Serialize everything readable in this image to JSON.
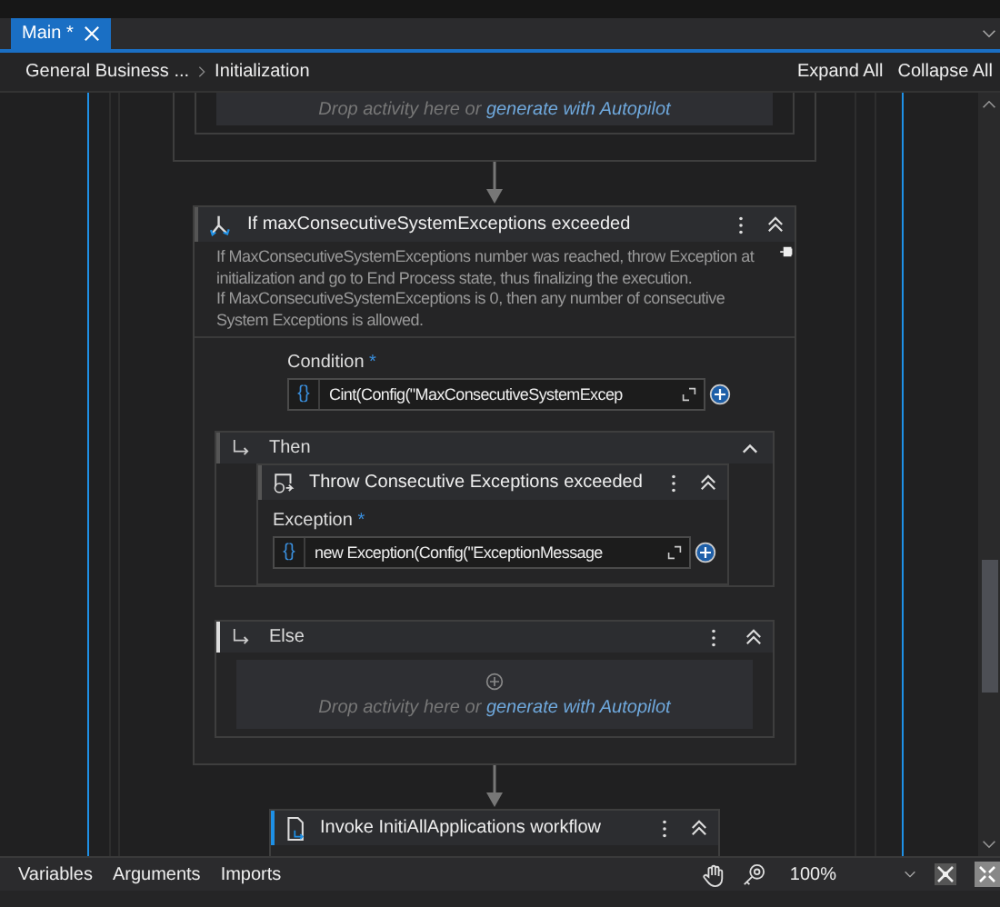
{
  "tabs": [
    {
      "label": "Main *",
      "selected": true
    }
  ],
  "breadcrumb": [
    "General Business ...",
    "Initialization"
  ],
  "toolbar_actions": [
    "Expand All",
    "Collapse All"
  ],
  "top_drop_zone": {
    "text": "Drop activity here or",
    "link": "generate with Autopilot"
  },
  "if_activity": {
    "title": "If maxConsecutiveSystemExceptions exceeded",
    "annotation": [
      "If MaxConsecutiveSystemExceptions number was reached, throw Exception at initialization and go to End Process state, thus finalizing the execution.",
      "If MaxConsecutiveSystemExceptions is 0, then any number of consecutive System Exceptions is allowed."
    ],
    "condition": {
      "label": "Condition",
      "required_mark": "*",
      "prefix": "{}",
      "value": "Cint(Config(\"MaxConsecutiveSystemExcep"
    },
    "then": {
      "label": "Then",
      "activity": {
        "title": "Throw Consecutive Exceptions exceeded",
        "field": {
          "label": "Exception",
          "required_mark": "*",
          "prefix": "{}",
          "value": "new Exception(Config(\"ExceptionMessage"
        }
      }
    },
    "else": {
      "label": "Else",
      "selected": true,
      "drop_zone": {
        "text": "Drop activity here or",
        "link": "generate with Autopilot"
      }
    }
  },
  "invoke_activity": {
    "title": "Invoke InitiAllApplications workflow"
  },
  "bottom_tabs": [
    "Variables",
    "Arguments",
    "Imports"
  ],
  "zoom": "100%"
}
